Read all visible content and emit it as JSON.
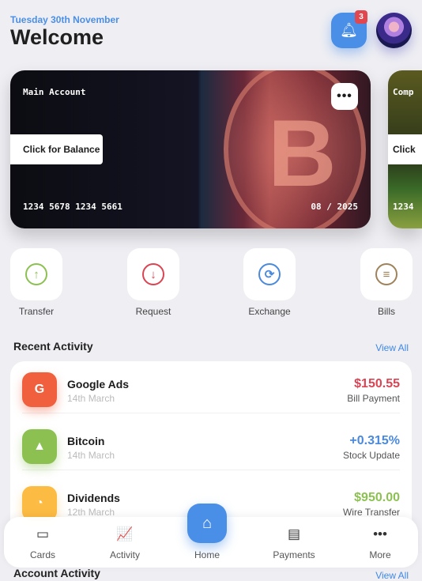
{
  "header": {
    "date": "Tuesday 30th November",
    "title": "Welcome",
    "notification_count": "3"
  },
  "cards": [
    {
      "name": "Main Account",
      "balance_button": "Click for Balance",
      "number": "1234 5678 1234 5661",
      "expiry": "08 / 2025",
      "menu": "•••"
    },
    {
      "name": "Comp",
      "balance_button": "Click",
      "number": "1234"
    }
  ],
  "actions": [
    {
      "label": "Transfer",
      "icon": "arrow-up-icon",
      "glyph": "↑",
      "color": "#8cc152"
    },
    {
      "label": "Request",
      "icon": "arrow-down-icon",
      "glyph": "↓",
      "color": "#da4453"
    },
    {
      "label": "Exchange",
      "icon": "exchange-icon",
      "glyph": "⟳",
      "color": "#4a89dc"
    },
    {
      "label": "Bills",
      "icon": "filter-icon",
      "glyph": "≡",
      "color": "#a0825a"
    }
  ],
  "recent": {
    "title": "Recent Activity",
    "view_all": "View All",
    "items": [
      {
        "name": "Google Ads",
        "date": "14th March",
        "amount": "$150.55",
        "type": "Bill Payment",
        "glyph": "G",
        "icon_color": "#f0603f",
        "amount_color": "#da4453"
      },
      {
        "name": "Bitcoin",
        "date": "14th March",
        "amount": "+0.315%",
        "type": "Stock Update",
        "glyph": "▲",
        "icon_color": "#8cc152",
        "amount_color": "#4a89dc"
      },
      {
        "name": "Dividends",
        "date": "12th March",
        "amount": "$950.00",
        "type": "Wire Transfer",
        "glyph": "◔",
        "icon_color": "#fcbb42",
        "amount_color": "#8cc152"
      }
    ]
  },
  "account_activity": {
    "title": "Account Activity",
    "view_all": "View All"
  },
  "nav": [
    {
      "label": "Cards",
      "glyph": "▭"
    },
    {
      "label": "Activity",
      "glyph": "📈"
    },
    {
      "label": "Home",
      "glyph": "⌂"
    },
    {
      "label": "Payments",
      "glyph": "▤"
    },
    {
      "label": "More",
      "glyph": "•••"
    }
  ]
}
